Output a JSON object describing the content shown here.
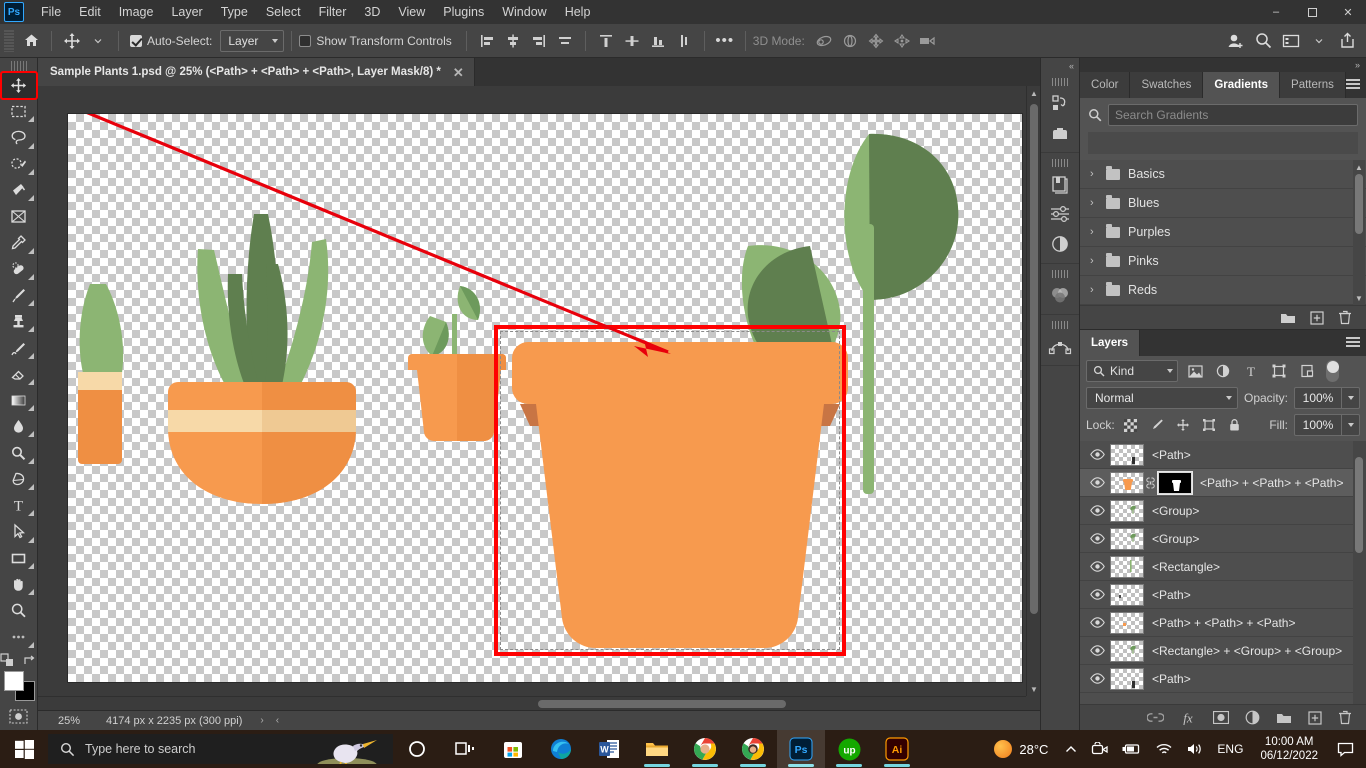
{
  "app": {
    "name": "Adobe Photoshop",
    "logo_text": "Ps"
  },
  "menubar": {
    "items": [
      "File",
      "Edit",
      "Image",
      "Layer",
      "Type",
      "Select",
      "Filter",
      "3D",
      "View",
      "Plugins",
      "Window",
      "Help"
    ],
    "window_controls": {
      "minimize": "–",
      "maximize": "❐",
      "close": "✕"
    }
  },
  "optionsbar": {
    "home_icon": "home-icon",
    "tool_icon": "move-tool-icon",
    "auto_select_label": "Auto-Select:",
    "auto_select_checked": true,
    "auto_select_scope": "Layer",
    "show_transform_label": "Show Transform Controls",
    "show_transform_checked": false,
    "more_label": "•••",
    "threed_mode_label": "3D Mode:",
    "align_icons": [
      "align-left-edges-icon",
      "align-horizontal-centers-icon",
      "align-right-edges-icon",
      "distribute-horizontally-icon"
    ],
    "align_icons2": [
      "align-top-edges-icon",
      "align-vertical-centers-icon",
      "align-bottom-edges-icon",
      "distribute-vertically-icon"
    ],
    "threed_icons": [
      "3d-orbit-icon",
      "3d-roll-icon",
      "3d-pan-icon",
      "3d-slide-icon",
      "3d-camera-icon"
    ],
    "right_icons": [
      "share-user-icon",
      "search-icon",
      "workspace-icon",
      "chevron-down-icon",
      "share-export-icon"
    ]
  },
  "toolbar": {
    "active_tool": "move-tool",
    "tools": [
      {
        "name": "move-tool",
        "has_flyout": false
      },
      {
        "name": "rectangular-marquee-tool",
        "has_flyout": true
      },
      {
        "name": "lasso-tool",
        "has_flyout": true
      },
      {
        "name": "object-selection-tool",
        "has_flyout": true
      },
      {
        "name": "crop-tool",
        "has_flyout": true
      },
      {
        "name": "frame-tool",
        "has_flyout": false
      },
      {
        "name": "eyedropper-tool",
        "has_flyout": true
      },
      {
        "name": "spot-healing-brush-tool",
        "has_flyout": true
      },
      {
        "name": "brush-tool",
        "has_flyout": true
      },
      {
        "name": "clone-stamp-tool",
        "has_flyout": true
      },
      {
        "name": "history-brush-tool",
        "has_flyout": true
      },
      {
        "name": "eraser-tool",
        "has_flyout": true
      },
      {
        "name": "gradient-tool",
        "has_flyout": true
      },
      {
        "name": "blur-tool",
        "has_flyout": true
      },
      {
        "name": "dodge-tool",
        "has_flyout": true
      },
      {
        "name": "pen-tool",
        "has_flyout": true
      },
      {
        "name": "type-tool",
        "has_flyout": true
      },
      {
        "name": "path-selection-tool",
        "has_flyout": true
      },
      {
        "name": "rectangle-tool",
        "has_flyout": true
      },
      {
        "name": "hand-tool",
        "has_flyout": true
      },
      {
        "name": "zoom-tool",
        "has_flyout": true
      },
      {
        "name": "edit-toolbar-tool",
        "has_flyout": true
      }
    ],
    "foreground_color": "#ffffff",
    "background_color": "#000000",
    "quick_mask_icon": "quick-mask-icon"
  },
  "document": {
    "tab_title": "Sample Plants 1.psd @ 25% (<Path> + <Path> + <Path>, Layer Mask/8) *",
    "close_icon": "✕"
  },
  "statusbar": {
    "zoom": "25%",
    "dimensions": "4174 px x 2235 px (300 ppi)",
    "next_arrow": "›",
    "prev_arrow": "‹"
  },
  "canvas": {
    "annotation_color": "#ff0000",
    "selection_rect_label": "red-annotation-rectangle",
    "arrow_label": "red-annotation-arrow",
    "colors": {
      "pot_light": "#f79a4e",
      "pot_mid": "#ef8f43",
      "pot_dark": "#c87544",
      "pot_band": "#f7d9a8",
      "leaf_light": "#8cb573",
      "leaf_dark": "#5f7f4f",
      "stem": "#8cb573"
    }
  },
  "rail": {
    "collapse_icon": "«",
    "icons": [
      "history-icon",
      "libraries-icon",
      "adjustments-presets-icon",
      "adjustments-icon",
      "adjustment-layer-icon",
      "channels-icon",
      "paths-icon"
    ]
  },
  "gradients_panel": {
    "collapse_icon": "»",
    "tabs": [
      {
        "label": "Color",
        "active": false
      },
      {
        "label": "Swatches",
        "active": false
      },
      {
        "label": "Gradients",
        "active": true
      },
      {
        "label": "Patterns",
        "active": false
      }
    ],
    "menu_icon": "panel-menu-icon",
    "search_placeholder": "Search Gradients",
    "search_value": "",
    "search_icon": "search-icon",
    "groups": [
      {
        "label": "Basics"
      },
      {
        "label": "Blues"
      },
      {
        "label": "Purples"
      },
      {
        "label": "Pinks"
      },
      {
        "label": "Reds"
      }
    ],
    "footer_icons": [
      "new-group-icon",
      "new-gradient-icon",
      "delete-icon"
    ]
  },
  "layers_panel": {
    "tabs": [
      {
        "label": "Layers",
        "active": true
      }
    ],
    "menu_icon": "panel-menu-icon",
    "filter_kind_label": "Kind",
    "filter_icons": [
      "filter-pixel-icon",
      "filter-adjustment-icon",
      "filter-type-icon",
      "filter-shape-icon",
      "filter-smart-object-icon"
    ],
    "filter_toggle": "filter-enable-toggle",
    "blend_mode": "Normal",
    "opacity_label": "Opacity:",
    "opacity_value": "100%",
    "lock_label": "Lock:",
    "lock_icons": [
      "lock-transparent-pixels-icon",
      "lock-image-pixels-icon",
      "lock-position-icon",
      "lock-artboard-icon",
      "lock-all-icon"
    ],
    "fill_label": "Fill:",
    "fill_value": "100%",
    "layers": [
      {
        "name": "<Path>",
        "visible": true,
        "selected": false,
        "has_mask": false,
        "thumb": "path-small"
      },
      {
        "name": "<Path> + <Path> + <Path>",
        "visible": true,
        "selected": true,
        "has_mask": true,
        "thumb": "pot"
      },
      {
        "name": "<Group>",
        "visible": true,
        "selected": false,
        "has_mask": false,
        "thumb": "leaf-small"
      },
      {
        "name": "<Group>",
        "visible": true,
        "selected": false,
        "has_mask": false,
        "thumb": "leaf-small"
      },
      {
        "name": "<Rectangle>",
        "visible": true,
        "selected": false,
        "has_mask": false,
        "thumb": "stem"
      },
      {
        "name": "<Path>",
        "visible": true,
        "selected": false,
        "has_mask": false,
        "thumb": "dot"
      },
      {
        "name": "<Path> + <Path> + <Path>",
        "visible": true,
        "selected": false,
        "has_mask": false,
        "thumb": "dot-orange"
      },
      {
        "name": "<Rectangle> + <Group> + <Group>",
        "visible": true,
        "selected": false,
        "has_mask": false,
        "thumb": "leaf-small"
      },
      {
        "name": "<Path>",
        "visible": true,
        "selected": false,
        "has_mask": false,
        "thumb": "path-small"
      }
    ],
    "footer_icons": [
      "link-layers-icon",
      "layer-style-fx-icon",
      "add-layer-mask-icon",
      "new-adjustment-layer-icon",
      "new-group-icon",
      "new-layer-icon",
      "delete-layer-icon"
    ]
  },
  "taskbar": {
    "start_label": "start-button",
    "search_placeholder": "Type here to search",
    "apps": [
      {
        "name": "cortana",
        "running": false,
        "active": false
      },
      {
        "name": "task-view",
        "running": false,
        "active": false
      },
      {
        "name": "microsoft-store",
        "running": false,
        "active": false
      },
      {
        "name": "microsoft-edge",
        "running": false,
        "active": false
      },
      {
        "name": "microsoft-word",
        "running": false,
        "active": false
      },
      {
        "name": "file-explorer",
        "running": true,
        "active": false
      },
      {
        "name": "google-chrome",
        "running": true,
        "active": false
      },
      {
        "name": "google-chrome-2",
        "running": true,
        "active": false
      },
      {
        "name": "adobe-photoshop",
        "running": true,
        "active": true
      },
      {
        "name": "upwork",
        "running": true,
        "active": false
      },
      {
        "name": "adobe-illustrator",
        "running": true,
        "active": false
      }
    ],
    "tray": {
      "temperature": "28°C",
      "show_hidden_icon": "chevron-up-icon",
      "icons": [
        "camera-icon",
        "battery-icon",
        "wifi-icon",
        "volume-icon"
      ],
      "language": "ENG",
      "time": "10:00 AM",
      "date": "06/12/2022",
      "notification_icon": "notification-icon"
    }
  }
}
